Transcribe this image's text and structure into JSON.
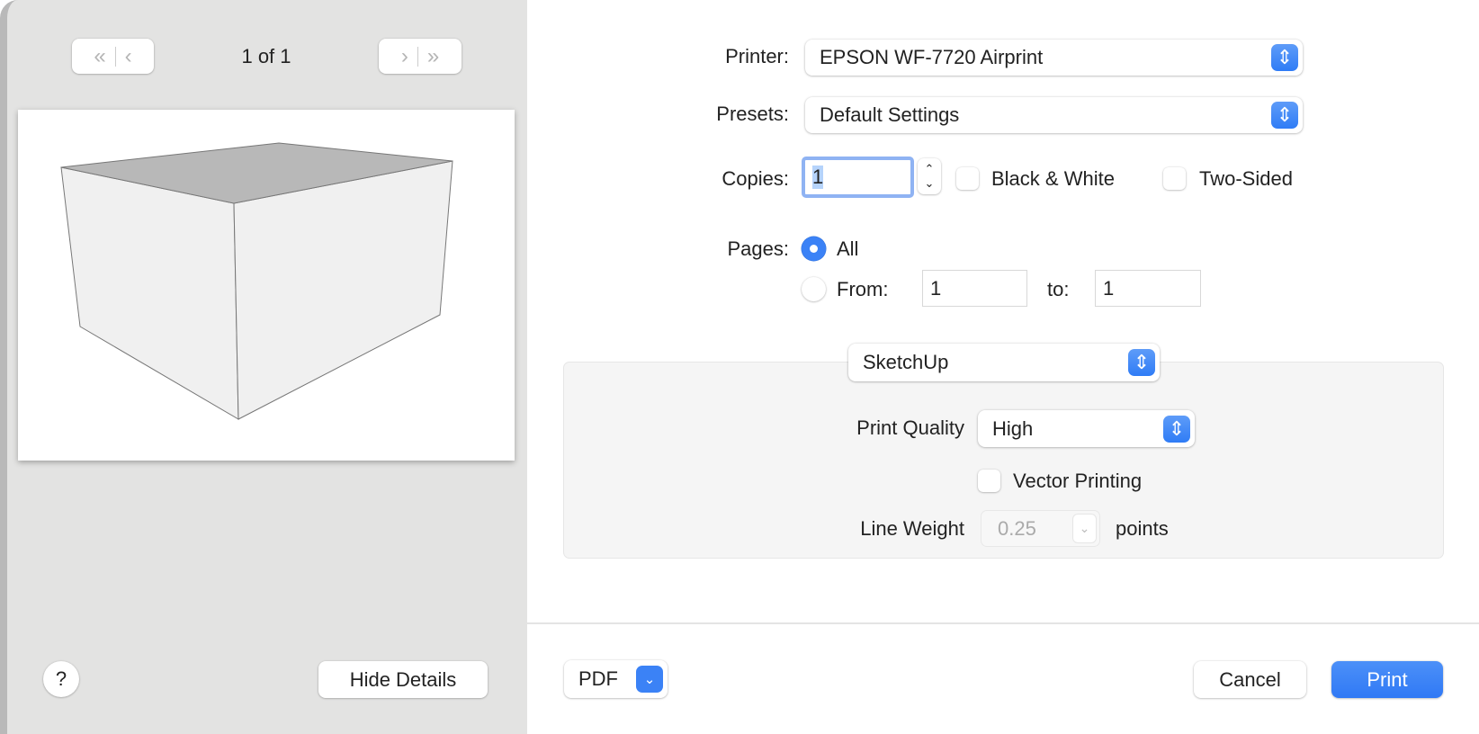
{
  "preview": {
    "page_indicator": "1 of 1"
  },
  "left_buttons": {
    "help": "?",
    "hide_details": "Hide Details"
  },
  "printer": {
    "label": "Printer:",
    "value": "EPSON WF-7720 Airprint"
  },
  "presets": {
    "label": "Presets:",
    "value": "Default Settings"
  },
  "copies": {
    "label": "Copies:",
    "value": "1",
    "black_white": "Black & White",
    "two_sided": "Two-Sided"
  },
  "pages": {
    "label": "Pages:",
    "all": "All",
    "from_label": "From:",
    "from_value": "1",
    "to_label": "to:",
    "to_value": "1"
  },
  "section": {
    "value": "SketchUp"
  },
  "sketchup": {
    "quality_label": "Print Quality",
    "quality_value": "High",
    "vector_label": "Vector Printing",
    "line_weight_label": "Line Weight",
    "line_weight_value": "0.25",
    "line_weight_unit": "points"
  },
  "footer": {
    "pdf": "PDF",
    "cancel": "Cancel",
    "print": "Print"
  },
  "colors": {
    "accent": "#3b82f6"
  }
}
